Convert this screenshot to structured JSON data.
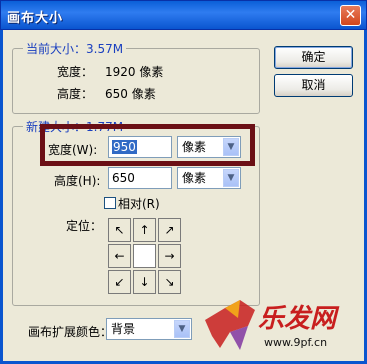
{
  "window": {
    "title": "画布大小"
  },
  "buttons": {
    "ok": "确定",
    "cancel": "取消"
  },
  "current_size": {
    "legend": "当前大小：3.57M",
    "width_label": "宽度：",
    "width_value": "1920 像素",
    "height_label": "高度：",
    "height_value": "650 像素"
  },
  "new_size": {
    "legend": "新建大小：1.77M",
    "width_label": "宽度(W):",
    "width_value": "950",
    "width_unit": "像素",
    "height_label": "高度(H):",
    "height_value": "650",
    "height_unit": "像素",
    "relative_label": "相对(R)",
    "anchor_label": "定位："
  },
  "extension": {
    "label": "画布扩展颜色：",
    "value": "背景"
  },
  "anchor_arrows": [
    "↖",
    "↑",
    "↗",
    "←",
    "",
    "→",
    "↙",
    "↓",
    "↘"
  ],
  "watermark": {
    "text": "乐发网",
    "url": "www.9pf.cn"
  },
  "colors": {
    "title_bar": "#0a5fd8",
    "legend_text": "#1a3fbf",
    "highlight_box": "#6b0f15",
    "watermark": "#c81e1e"
  }
}
